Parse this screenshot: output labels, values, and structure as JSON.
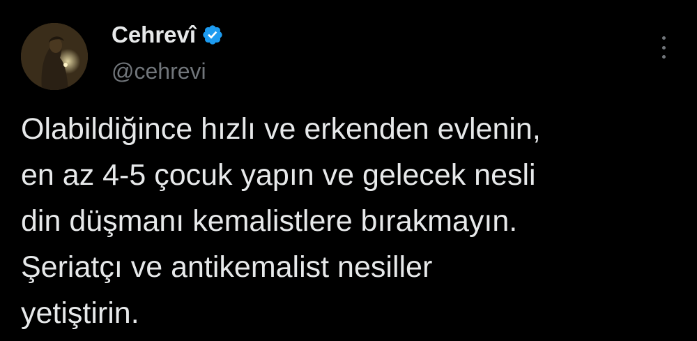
{
  "author": {
    "display_name": "Cehrevî",
    "handle": "@cehrevi",
    "verified": true,
    "verified_icon": "verified-badge-icon",
    "verified_color": "#1d9bf0",
    "avatar_icon": "profile-avatar"
  },
  "more_icon": "more-vertical-icon",
  "tweet": {
    "lines": [
      "Olabildiğince hızlı ve erkenden evlenin,",
      "en az 4-5 çocuk yapın ve gelecek nesli",
      "din düşmanı kemalistlere bırakmayın.",
      "Şeriatçı ve antikemalist nesiller",
      "yetiştirin."
    ]
  },
  "colors": {
    "background": "#000000",
    "text": "#e7e9ea",
    "secondary_text": "#71767b"
  }
}
